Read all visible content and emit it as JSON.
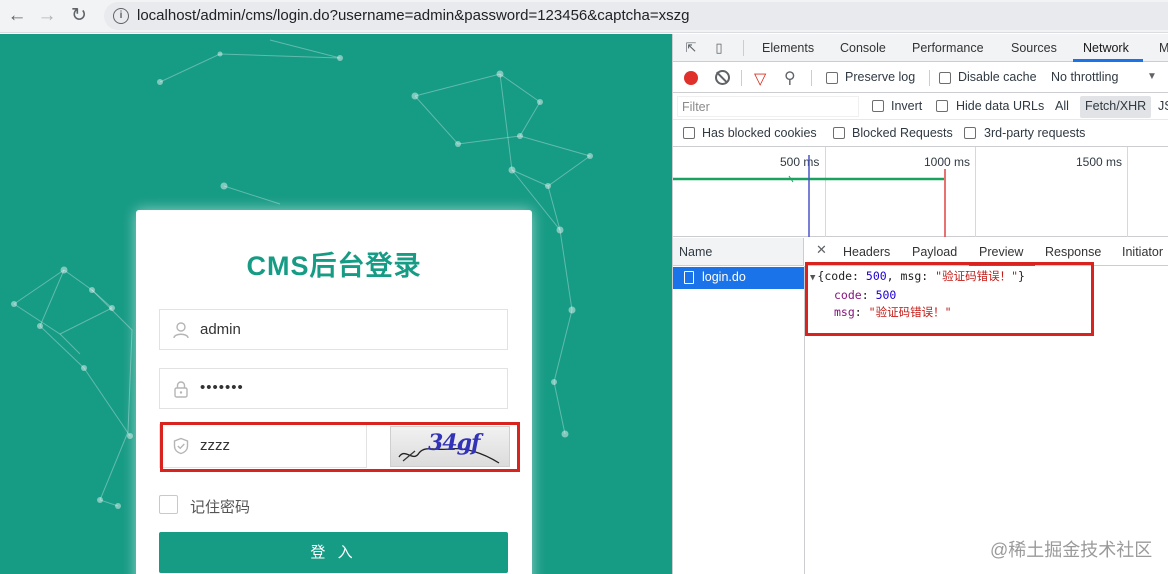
{
  "browser": {
    "url": "localhost/admin/cms/login.do?username=admin&password=123456&captcha=xszg",
    "back_icon": "arrow-left-icon",
    "forward_icon": "arrow-right-icon",
    "reload_icon": "reload-icon",
    "info_icon": "info-icon"
  },
  "login": {
    "title": "CMS后台登录",
    "username": "admin",
    "password": "•••••••",
    "captcha_input": "zzzz",
    "captcha_image_text": "34gf",
    "remember_label": "记住密码",
    "login_button": "登 入",
    "accent_color": "#169b85",
    "highlight_color": "#d9231f"
  },
  "devtools": {
    "tabs": [
      "Elements",
      "Console",
      "Performance",
      "Sources",
      "Network",
      "M"
    ],
    "active_tab": "Network",
    "toolbar": {
      "preserve_log": "Preserve log",
      "disable_cache": "Disable cache",
      "throttling": "No throttling"
    },
    "filter": {
      "placeholder": "Filter",
      "invert": "Invert",
      "hide_data_urls": "Hide data URLs",
      "all": "All",
      "fetch_xhr": "Fetch/XHR",
      "js": "JS"
    },
    "filter2": {
      "blocked_cookies": "Has blocked cookies",
      "blocked_requests": "Blocked Requests",
      "third_party": "3rd-party requests"
    },
    "timeline": {
      "ticks": [
        "500 ms",
        "1000 ms",
        "1500 ms"
      ]
    },
    "request_list": {
      "header": "Name",
      "items": [
        "login.do"
      ]
    },
    "detail_tabs": [
      "Headers",
      "Payload",
      "Preview",
      "Response",
      "Initiator"
    ],
    "active_detail_tab": "Preview",
    "preview": {
      "summary_open": "{code: ",
      "summary_code": "500",
      "summary_mid": ", msg: ",
      "summary_msg": "\"验证码错误！\"",
      "summary_close": "}",
      "code_key": "code",
      "code_value": "500",
      "msg_key": "msg",
      "msg_value": "\"验证码错误！\""
    }
  },
  "watermark": "@稀土掘金技术社区"
}
